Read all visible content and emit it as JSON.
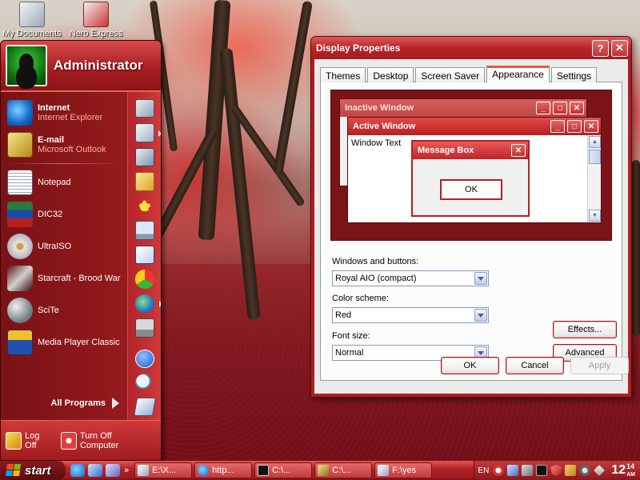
{
  "desktop": {
    "icons": [
      {
        "label": "My Documents",
        "icon": "folder-documents-icon"
      },
      {
        "label": "Nero Express",
        "icon": "nero-express-icon"
      }
    ]
  },
  "start_menu": {
    "user_name": "Administrator",
    "pinned": [
      {
        "title": "Internet",
        "subtitle": "Internet Explorer",
        "icon": "internet-explorer-icon"
      },
      {
        "title": "E-mail",
        "subtitle": "Microsoft Outlook",
        "icon": "outlook-icon"
      }
    ],
    "recent": [
      {
        "label": "Notepad",
        "icon": "notepad-icon"
      },
      {
        "label": "DIC32",
        "icon": "dictionary-books-icon"
      },
      {
        "label": "UltraISO",
        "icon": "ultraiso-disc-icon"
      },
      {
        "label": "Starcraft - Brood War",
        "icon": "starcraft-icon"
      },
      {
        "label": "SciTe",
        "icon": "scite-icon"
      },
      {
        "label": "Media Player Classic",
        "icon": "media-player-classic-icon"
      }
    ],
    "all_programs": "All Programs",
    "log_off": "Log Off",
    "turn_off": "Turn Off Computer"
  },
  "display_properties": {
    "title": "Display Properties",
    "help_glyph": "?",
    "close_glyph": "✕",
    "tabs": [
      "Themes",
      "Desktop",
      "Screen Saver",
      "Appearance",
      "Settings"
    ],
    "active_tab": "Appearance",
    "preview": {
      "inactive_title": "Inactive Window",
      "active_title": "Active Window",
      "window_text": "Window Text",
      "message_title": "Message Box",
      "ok": "OK"
    },
    "windows_buttons_label": "Windows and buttons:",
    "windows_buttons_value": "Royal AIO (compact)",
    "color_scheme_label": "Color scheme:",
    "color_scheme_value": "Red",
    "font_size_label": "Font size:",
    "font_size_value": "Normal",
    "effects": "Effects...",
    "advanced": "Advanced",
    "ok": "OK",
    "cancel": "Cancel",
    "apply": "Apply"
  },
  "taskbar": {
    "start": "start",
    "quick_launch_more": "»",
    "tasks": [
      {
        "label": "E:\\X...",
        "icon": "folder-window-icon"
      },
      {
        "label": "http...",
        "icon": "ie-window-icon"
      },
      {
        "label": "C:\\...",
        "icon": "command-prompt-icon"
      },
      {
        "label": "C:\\...",
        "icon": "explorer-window-icon"
      },
      {
        "label": "F:\\yes",
        "icon": "folder-window-icon"
      }
    ],
    "lang": "EN",
    "clock_hour": "12",
    "clock_minute": "14",
    "clock_ampm": "AM"
  },
  "colors": {
    "theme_red": "#b01e22",
    "dark_red": "#6e0f12",
    "accent_orange": "#e85a3a"
  }
}
